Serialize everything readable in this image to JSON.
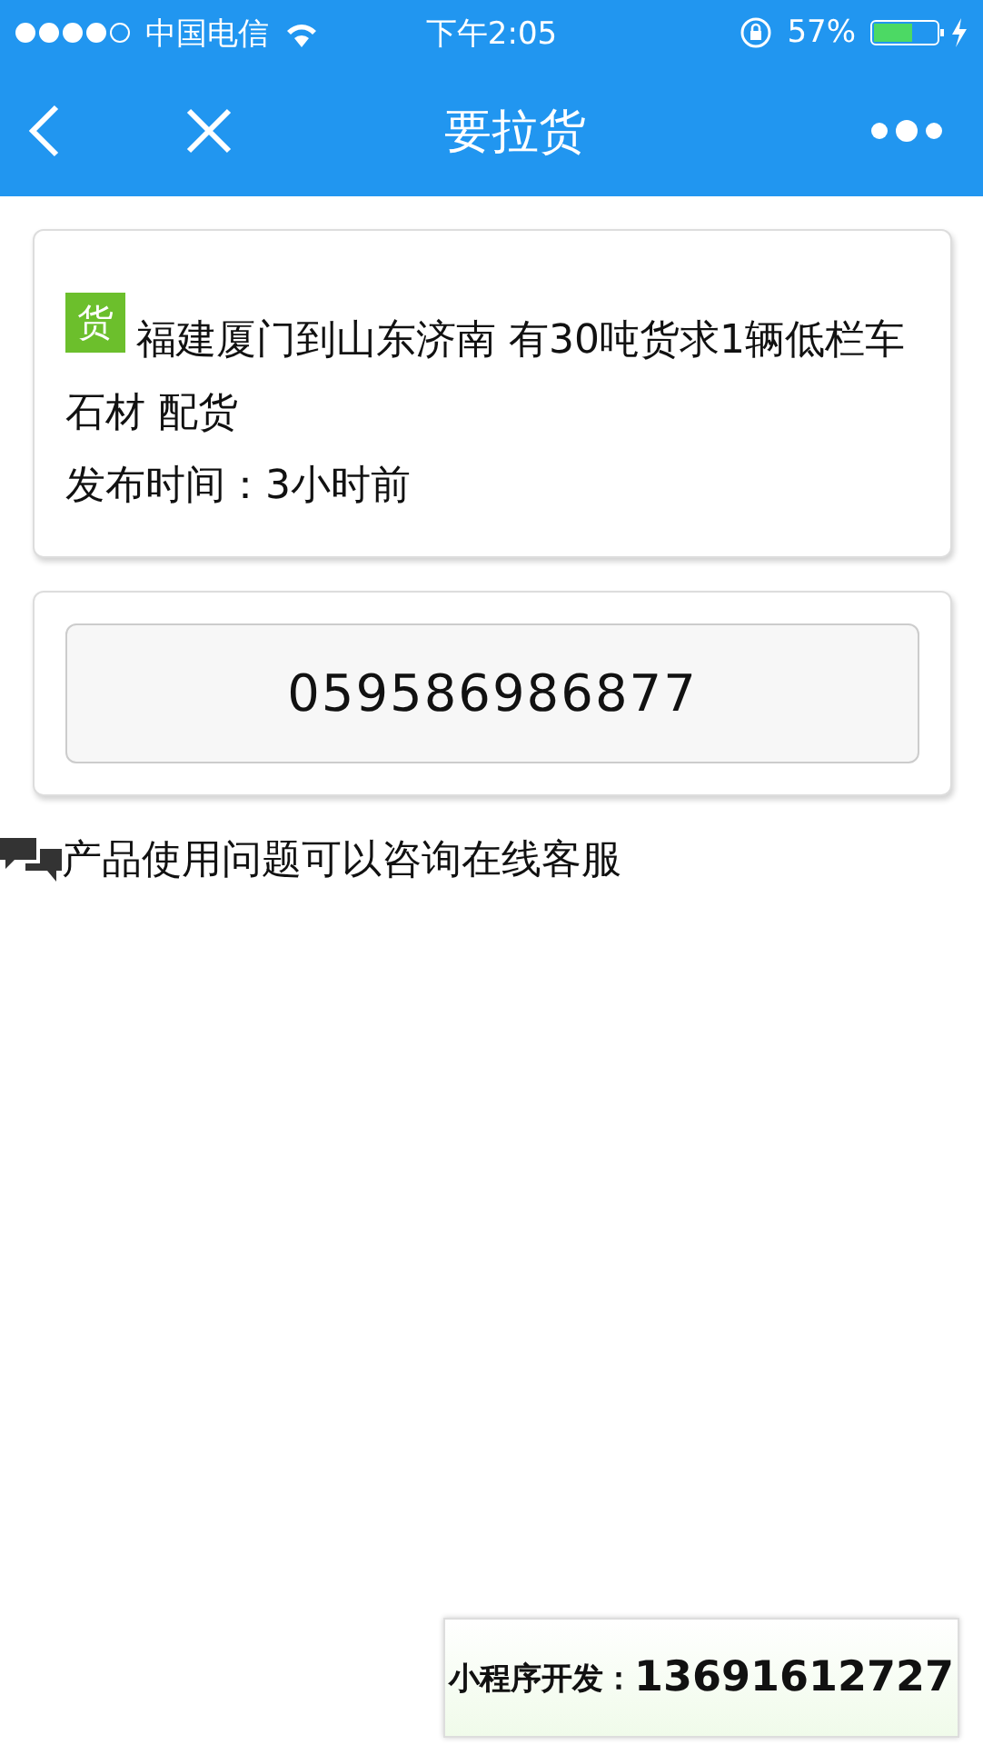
{
  "status_bar": {
    "carrier": "中国电信",
    "time": "下午2:05",
    "battery": "57%"
  },
  "nav_bar": {
    "title": "要拉货"
  },
  "post": {
    "tag": "货",
    "title": "福建厦门到山东济南 有30吨货求1辆低栏车石材 配货",
    "published": "发布时间：3小时前"
  },
  "contact": {
    "phone": "059586986877"
  },
  "help": {
    "text": "产品使用问题可以咨询在线客服"
  },
  "ad_badge": {
    "label": "小程序开发：",
    "phone": "13691612727"
  }
}
